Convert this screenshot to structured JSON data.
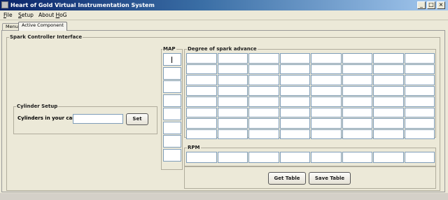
{
  "window": {
    "title": "Heart of Gold Virtual Instrumentation System",
    "controls": {
      "minimize": "_",
      "maximize": "□",
      "close": "×"
    }
  },
  "menubar": {
    "items": [
      {
        "mnemonic": "F",
        "rest": "ile"
      },
      {
        "mnemonic": "S",
        "rest": "etup"
      },
      {
        "before": "About ",
        "mnemonic": "H",
        "rest": "oG"
      }
    ]
  },
  "tabs": [
    {
      "label": "Menu",
      "active": false
    },
    {
      "label": "Active Component",
      "active": true
    }
  ],
  "spark": {
    "title": "Spark Controller Interface",
    "cylinder_setup": {
      "title": "Cylinder Setup",
      "label": "Cylinders in your car:",
      "value": "",
      "set_button": "Set"
    },
    "map": {
      "title": "MAP",
      "rows": 8
    },
    "advance": {
      "title": "Degree of spark advance",
      "rows": 8,
      "cols": 8
    },
    "rpm": {
      "title": "RPM",
      "cols": 8
    },
    "get_table_button": "Get Table",
    "save_table_button": "Save Table"
  },
  "colors": {
    "title_gradient_start": "#0a246a",
    "title_gradient_end": "#a6caf0",
    "window_bg": "#ece9d8",
    "field_border": "#7f9db9"
  }
}
